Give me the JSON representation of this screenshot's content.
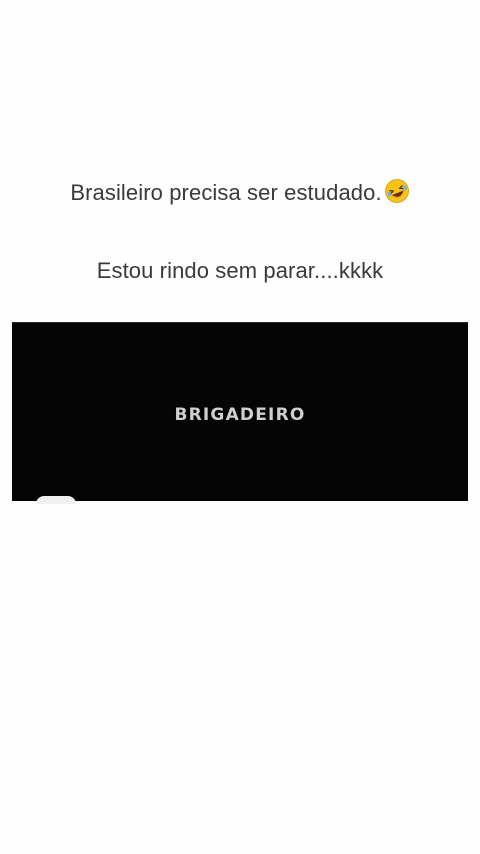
{
  "captions": {
    "line1": "Brasileiro precisa ser estudado.",
    "line1_emoji": "rolling-on-floor-laughing-emoji",
    "line2": "Estou rindo sem parar....kkkk"
  },
  "video": {
    "title": "BRIGADEIRO"
  },
  "colors": {
    "background": "#fefefe",
    "text": "#3a3a3a",
    "video_bg": "#050505",
    "video_title": "#cfcfcf",
    "emoji_face": "#f7c21a"
  }
}
